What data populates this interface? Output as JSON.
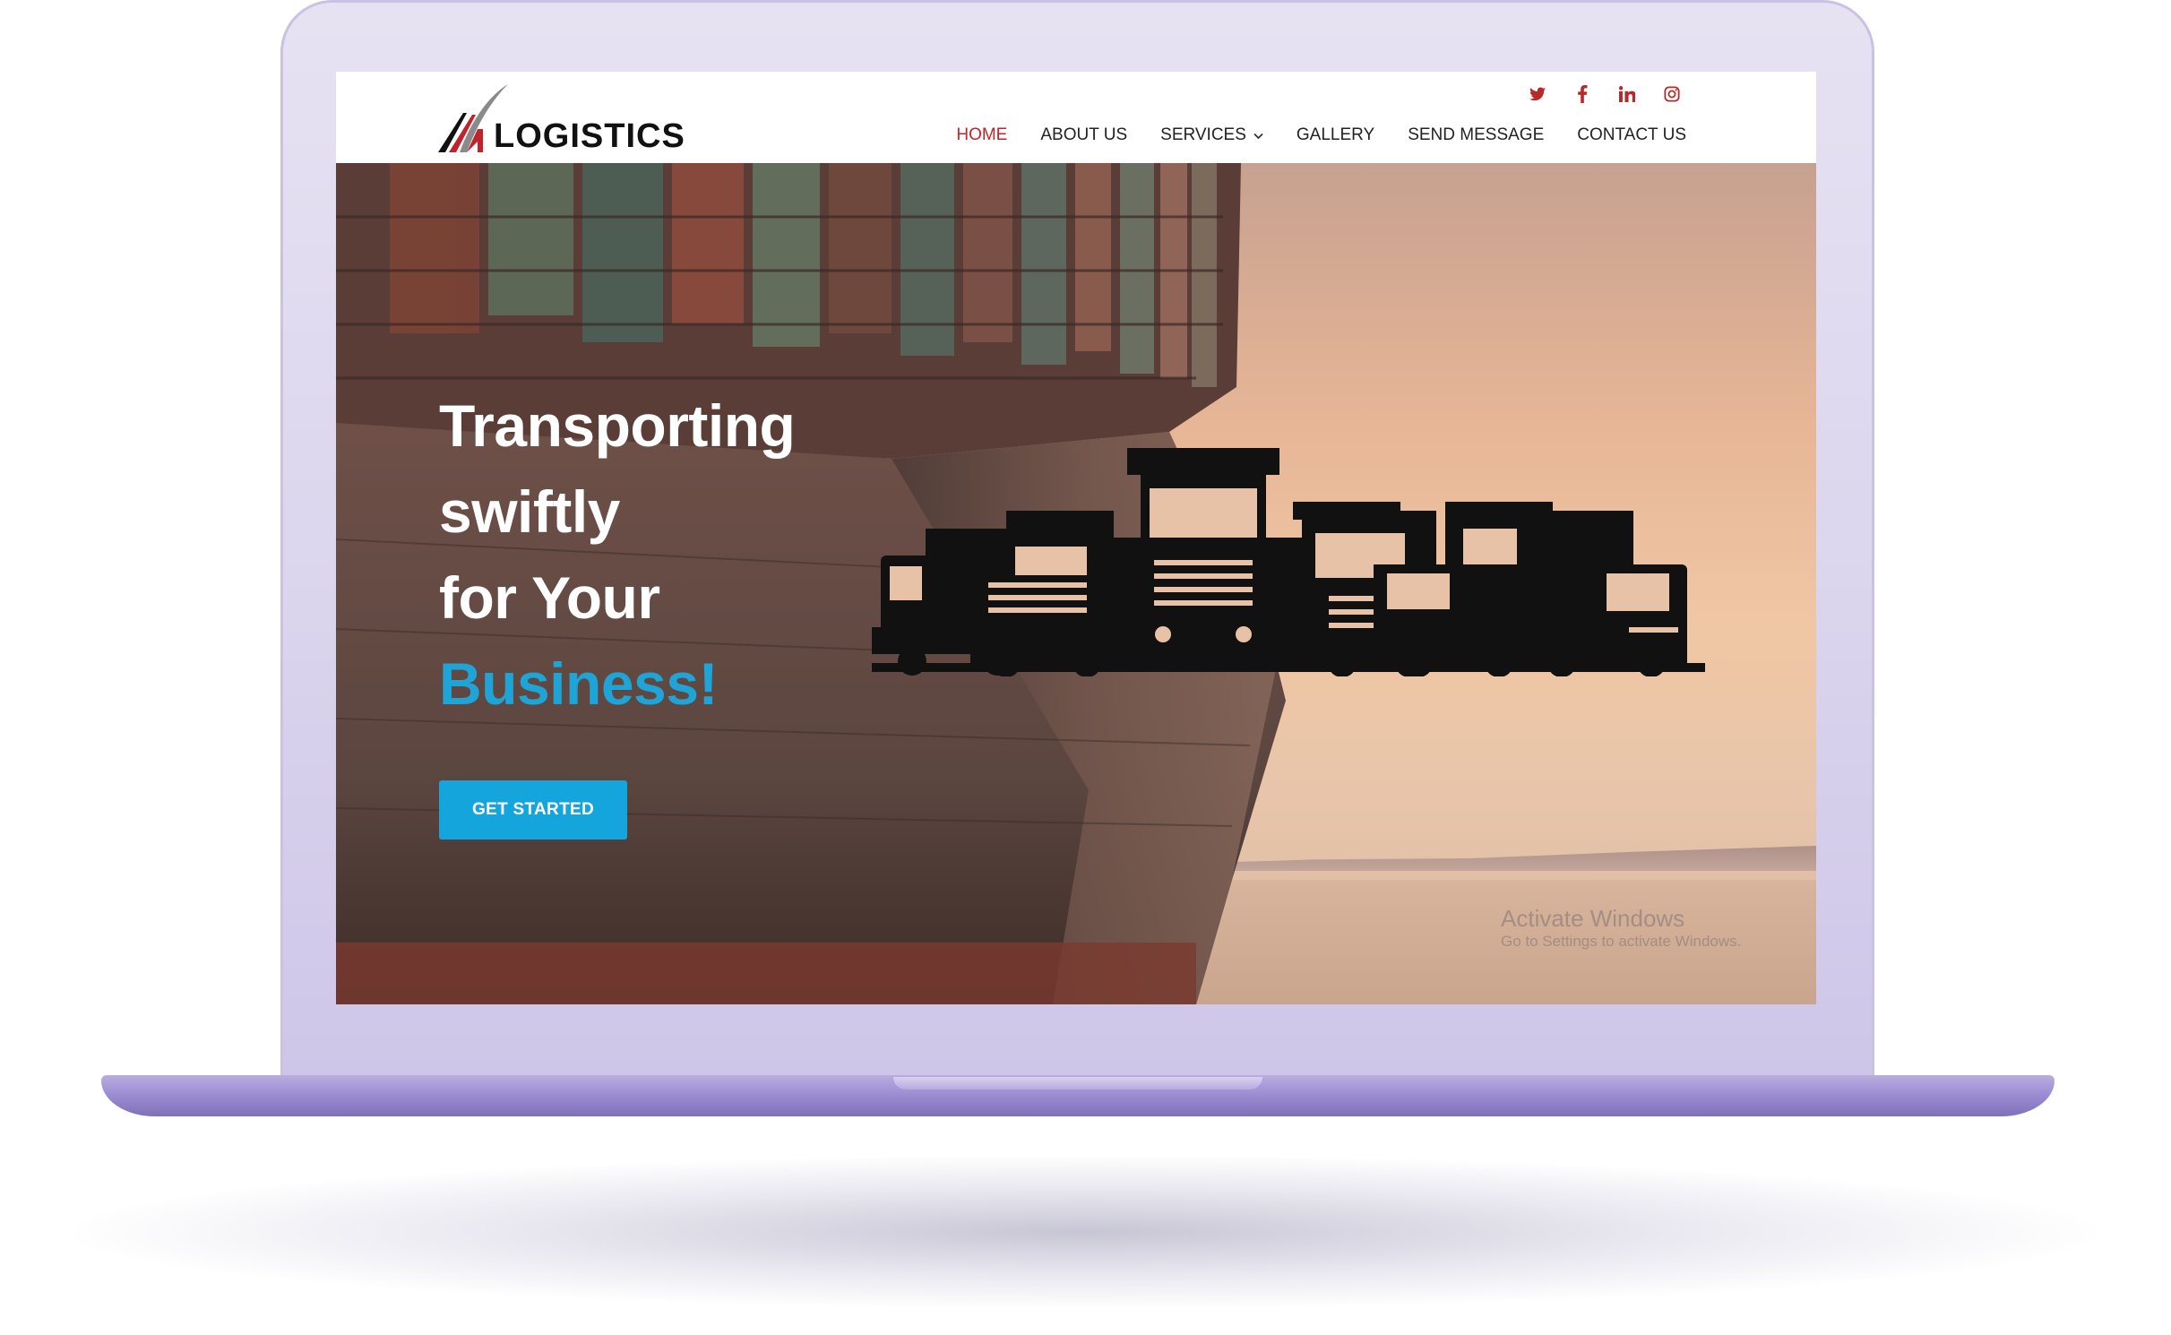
{
  "brand": {
    "logo_text": "LOGISTICS"
  },
  "social": [
    {
      "name": "twitter-icon",
      "glyph": "𝕂"
    },
    {
      "name": "facebook-icon",
      "glyph": "f"
    },
    {
      "name": "linkedin-icon",
      "glyph": "in"
    },
    {
      "name": "instagram-icon",
      "glyph": "○"
    }
  ],
  "nav": {
    "home": "HOME",
    "about": "ABOUT US",
    "services": "SERVICES",
    "gallery": "GALLERY",
    "send_message": "SEND MESSAGE",
    "contact": "CONTACT US"
  },
  "hero": {
    "line1": "Transporting",
    "line2": "swiftly",
    "line3": "for Your",
    "line4": "Business!",
    "cta_label": "GET STARTED"
  },
  "watermark": {
    "line1": "Activate Windows",
    "line2": "Go to Settings to activate Windows."
  },
  "colors": {
    "accent": "#1ea4d6",
    "nav_active": "#c0232b",
    "social": "#b52a2a",
    "laptop": "#dcd6ee"
  }
}
